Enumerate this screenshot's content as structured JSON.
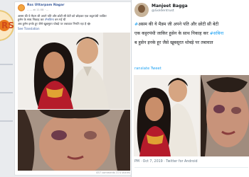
{
  "facebook": {
    "logo_text": "RSS",
    "page_name": "Rss Uttarpam Nagar",
    "timestamp": "…… at 11:58 · …",
    "post_text_line1": "असम की ये मैडम जी अपने पति और छोटी सी बेटी को छोड़कर एक कट्टरपंथी जाकिर",
    "post_text_line2": "हुसेन के साथ निकाह कर",
    "post_hashtag": "#सबिना",
    "post_text_line2_end": "बन गई थी",
    "post_text_line3": "अब हुसेन इनके हूर जैसे खूबसूरत थोबड़े पर तबावात गिनति रहा है 😂",
    "see_translation": "See Translation",
    "footer_counts": "457 comments  374 shares"
  },
  "twitter": {
    "name": "Manjeet Bagga",
    "handle": "@Goldentrust",
    "line1_text": "असम की ये मैडम जी अपने पति और छोटी सी बेटी",
    "line1_prefix": "#",
    "line2_text": "एक कट्टरपंथी जाकिर हुसेन के साथ निकाह कर",
    "line2_hashtag": "#सबिना",
    "line3_text": "ब हुसेन इनके हूर जैसे खूबसूरत थोबड़े पर तबावात",
    "translate": "ranslate Tweet",
    "meta": "PM · Oct 7, 2019 · Twitter for Android"
  },
  "colors": {
    "facebook_link": "#365899",
    "twitter_link": "#1da1f2",
    "twitter_hashtag": "#1da1f2"
  }
}
